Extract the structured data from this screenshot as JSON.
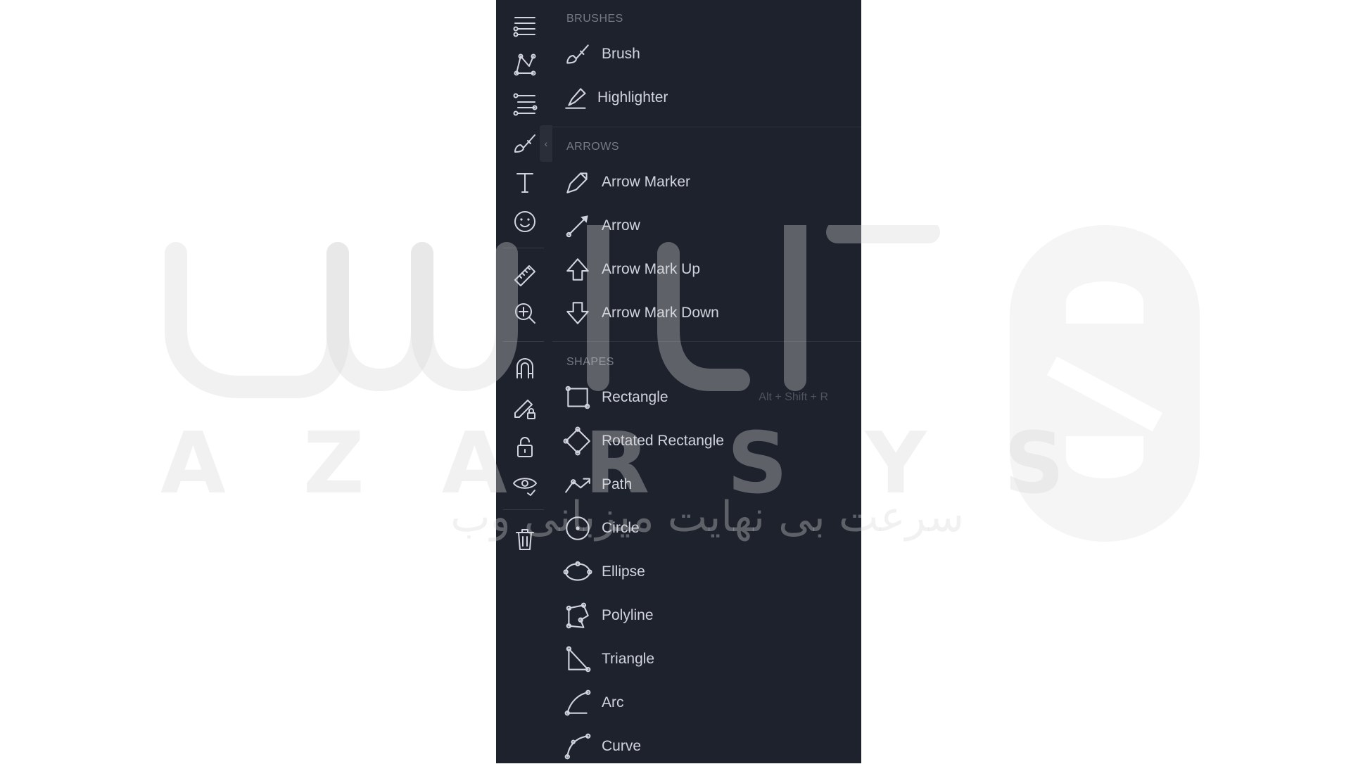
{
  "toolbar": {
    "tools": [
      {
        "name": "trend-line-tools-icon"
      },
      {
        "name": "pattern-tools-icon"
      },
      {
        "name": "fib-tools-icon"
      },
      {
        "name": "brush-tools-icon"
      },
      {
        "name": "text-tool-icon"
      },
      {
        "name": "emoji-icon"
      },
      {
        "name": "ruler-icon"
      },
      {
        "name": "zoom-in-icon"
      },
      {
        "name": "magnet-icon"
      },
      {
        "name": "lock-drawing-icon"
      },
      {
        "name": "unlock-icon"
      },
      {
        "name": "eye-icon"
      },
      {
        "name": "trash-icon"
      }
    ],
    "collapse_glyph": "‹"
  },
  "menu": {
    "sections": [
      {
        "title": "BRUSHES",
        "items": [
          {
            "label": "Brush",
            "icon": "brush-icon"
          },
          {
            "label": "Highlighter",
            "icon": "highlighter-icon"
          }
        ]
      },
      {
        "title": "ARROWS",
        "items": [
          {
            "label": "Arrow Marker",
            "icon": "arrow-marker-icon"
          },
          {
            "label": "Arrow",
            "icon": "arrow-icon"
          },
          {
            "label": "Arrow Mark Up",
            "icon": "arrow-up-icon"
          },
          {
            "label": "Arrow Mark Down",
            "icon": "arrow-down-icon"
          }
        ]
      },
      {
        "title": "SHAPES",
        "items": [
          {
            "label": "Rectangle",
            "icon": "rectangle-icon",
            "shortcut": "Alt + Shift + R"
          },
          {
            "label": "Rotated Rectangle",
            "icon": "rotated-rectangle-icon"
          },
          {
            "label": "Path",
            "icon": "path-icon"
          },
          {
            "label": "Circle",
            "icon": "circle-icon"
          },
          {
            "label": "Ellipse",
            "icon": "ellipse-icon"
          },
          {
            "label": "Polyline",
            "icon": "polyline-icon"
          },
          {
            "label": "Triangle",
            "icon": "triangle-icon"
          },
          {
            "label": "Arc",
            "icon": "arc-icon"
          },
          {
            "label": "Curve",
            "icon": "curve-icon"
          }
        ]
      }
    ]
  },
  "watermark": {
    "latin": "AZARSYS",
    "persian": "سرعت بی نهایت میزبانی وب"
  },
  "colors": {
    "panel_bg": "#1e222d",
    "text": "#d1d4dc",
    "section_text": "#787b86",
    "divider": "#2f333e"
  }
}
